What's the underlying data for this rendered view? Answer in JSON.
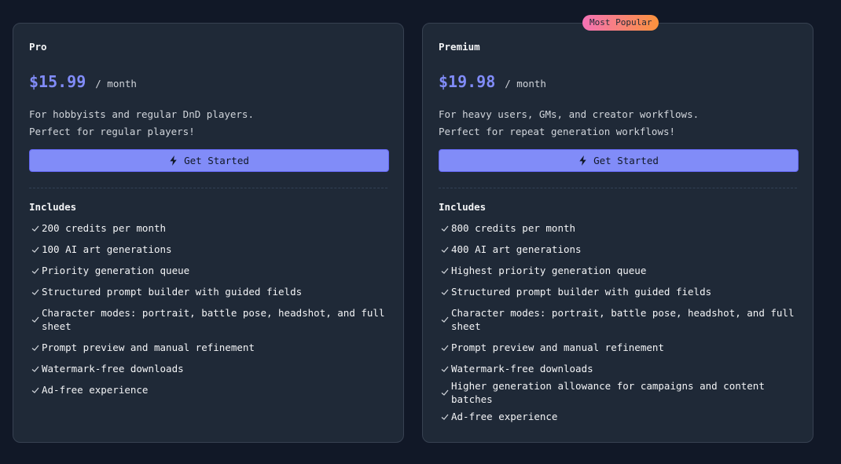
{
  "plans": [
    {
      "name": "Pro",
      "price": "$15.99",
      "period": "/ month",
      "description_lines": [
        "For hobbyists and regular DnD players.",
        "Perfect for regular players!"
      ],
      "cta_label": "Get Started",
      "includes_title": "Includes",
      "features": [
        "200 credits per month",
        "100 AI art generations",
        "Priority generation queue",
        "Structured prompt builder with guided fields",
        "Character modes: portrait, battle pose, headshot, and full sheet",
        "Prompt preview and manual refinement",
        "Watermark-free downloads",
        "Ad-free experience"
      ]
    },
    {
      "name": "Premium",
      "badge": "Most Popular",
      "price": "$19.98",
      "period": "/ month",
      "description_lines": [
        "For heavy users, GMs, and creator workflows.",
        "Perfect for repeat generation workflows!"
      ],
      "cta_label": "Get Started",
      "includes_title": "Includes",
      "features": [
        "800 credits per month",
        "400 AI art generations",
        "Highest priority generation queue",
        "Structured prompt builder with guided fields",
        "Character modes: portrait, battle pose, headshot, and full sheet",
        "Prompt preview and manual refinement",
        "Watermark-free downloads",
        "Higher generation allowance for campaigns and content batches",
        "Ad-free experience"
      ]
    }
  ],
  "icons": {
    "cta": "bolt-icon",
    "feature": "check-icon"
  },
  "colors": {
    "accent": "#818cf8",
    "badge_from": "#f472b6",
    "badge_to": "#fb923c",
    "card_bg": "#1f2937",
    "page_bg": "#111827"
  }
}
